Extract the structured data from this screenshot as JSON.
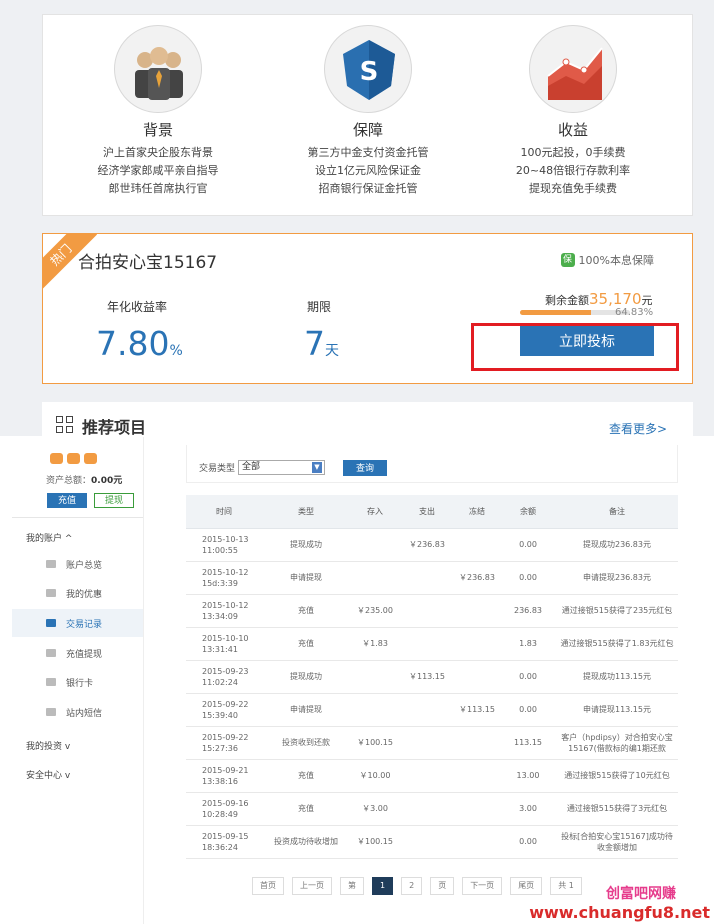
{
  "features": [
    {
      "icon": "businessmen-icon",
      "title": "背景",
      "lines": [
        "沪上首家央企股东背景",
        "经济学家郎咸平亲自指导",
        "郎世玮任首席执行官"
      ]
    },
    {
      "icon": "shield-s-icon",
      "title": "保障",
      "lines": [
        "第三方中金支付资金托管",
        "设立1亿元风险保证金",
        "招商银行保证金托管"
      ]
    },
    {
      "icon": "growth-chart-icon",
      "title": "收益",
      "lines": [
        "100元起投，0手续费",
        "20~48倍银行存款利率",
        "提现充值免手续费"
      ]
    }
  ],
  "product": {
    "hot_label": "热门",
    "name": "合拍安心宝15167",
    "guarantee_badge": "保",
    "guarantee_text": "100%本息保障",
    "rate_label": "年化收益率",
    "rate_value": "7.80",
    "rate_unit": "%",
    "term_label": "期限",
    "term_value": "7",
    "term_unit": "天",
    "remain_label": "剩余金额",
    "remain_amount": "35,170",
    "remain_unit": "元",
    "progress_percent": 64.83,
    "progress_text": "64.83%",
    "invest_button": "立即投标"
  },
  "recommend": {
    "title": "推荐项目",
    "more_link": "查看更多>"
  },
  "account": {
    "assets_label": "资产总额：",
    "assets_value": "0.00元",
    "recharge_button": "充值",
    "withdraw_button": "提现",
    "menu_my_account": "我的账户 ^",
    "menu_items": [
      {
        "label": "账户总览",
        "icon": "user-icon"
      },
      {
        "label": "我的优惠",
        "icon": "coupon-icon"
      },
      {
        "label": "交易记录",
        "icon": "exchange-icon",
        "active": true
      },
      {
        "label": "充值提现",
        "icon": "yen-icon"
      },
      {
        "label": "银行卡",
        "icon": "card-icon"
      },
      {
        "label": "站内短信",
        "icon": "mail-icon"
      }
    ],
    "menu_my_invest": "我的投资 v",
    "menu_security": "安全中心 v"
  },
  "filter": {
    "label": "交易类型",
    "selected": "全部",
    "query_button": "查询"
  },
  "table": {
    "headers": [
      "时间",
      "类型",
      "存入",
      "支出",
      "冻结",
      "余额",
      "备注"
    ],
    "rows": [
      [
        "2015-10-13\n11:00:55",
        "提现成功",
        "",
        "￥236.83",
        "",
        "0.00",
        "提现成功236.83元"
      ],
      [
        "2015-10-12\n15d:3:39",
        "申请提现",
        "",
        "",
        "￥236.83",
        "0.00",
        "申请提现236.83元"
      ],
      [
        "2015-10-12\n13:34:09",
        "充值",
        "￥235.00",
        "",
        "",
        "236.83",
        "通过接银515获得了235元红包"
      ],
      [
        "2015-10-10\n13:31:41",
        "充值",
        "￥1.83",
        "",
        "",
        "1.83",
        "通过接银515获得了1.83元红包"
      ],
      [
        "2015-09-23\n11:02:24",
        "提现成功",
        "",
        "￥113.15",
        "",
        "0.00",
        "提现成功113.15元"
      ],
      [
        "2015-09-22\n15:39:40",
        "申请提现",
        "",
        "",
        "￥113.15",
        "0.00",
        "申请提现113.15元"
      ],
      [
        "2015-09-22\n15:27:36",
        "投资收到还款",
        "￥100.15",
        "",
        "",
        "113.15",
        "客户（hpdipsy）对合拍安心宝15167(借款标的编1期还款"
      ],
      [
        "2015-09-21\n13:38:16",
        "充值",
        "￥10.00",
        "",
        "",
        "13.00",
        "通过接银515获得了10元红包"
      ],
      [
        "2015-09-16\n10:28:49",
        "充值",
        "￥3.00",
        "",
        "",
        "3.00",
        "通过接银515获得了3元红包"
      ],
      [
        "2015-09-15\n18:36:24",
        "投资成功待收增加",
        "￥100.15",
        "",
        "",
        "0.00",
        "投标[合拍安心宝15167]成功待收金额增加"
      ]
    ]
  },
  "pager": {
    "items": [
      "首页",
      "上一页",
      "第",
      "1",
      "2",
      "页",
      "下一页",
      "尾页",
      "共 1"
    ],
    "current": "1"
  },
  "watermark": {
    "cn": "创富吧网赚",
    "url": "www.chuangfu8.net"
  }
}
